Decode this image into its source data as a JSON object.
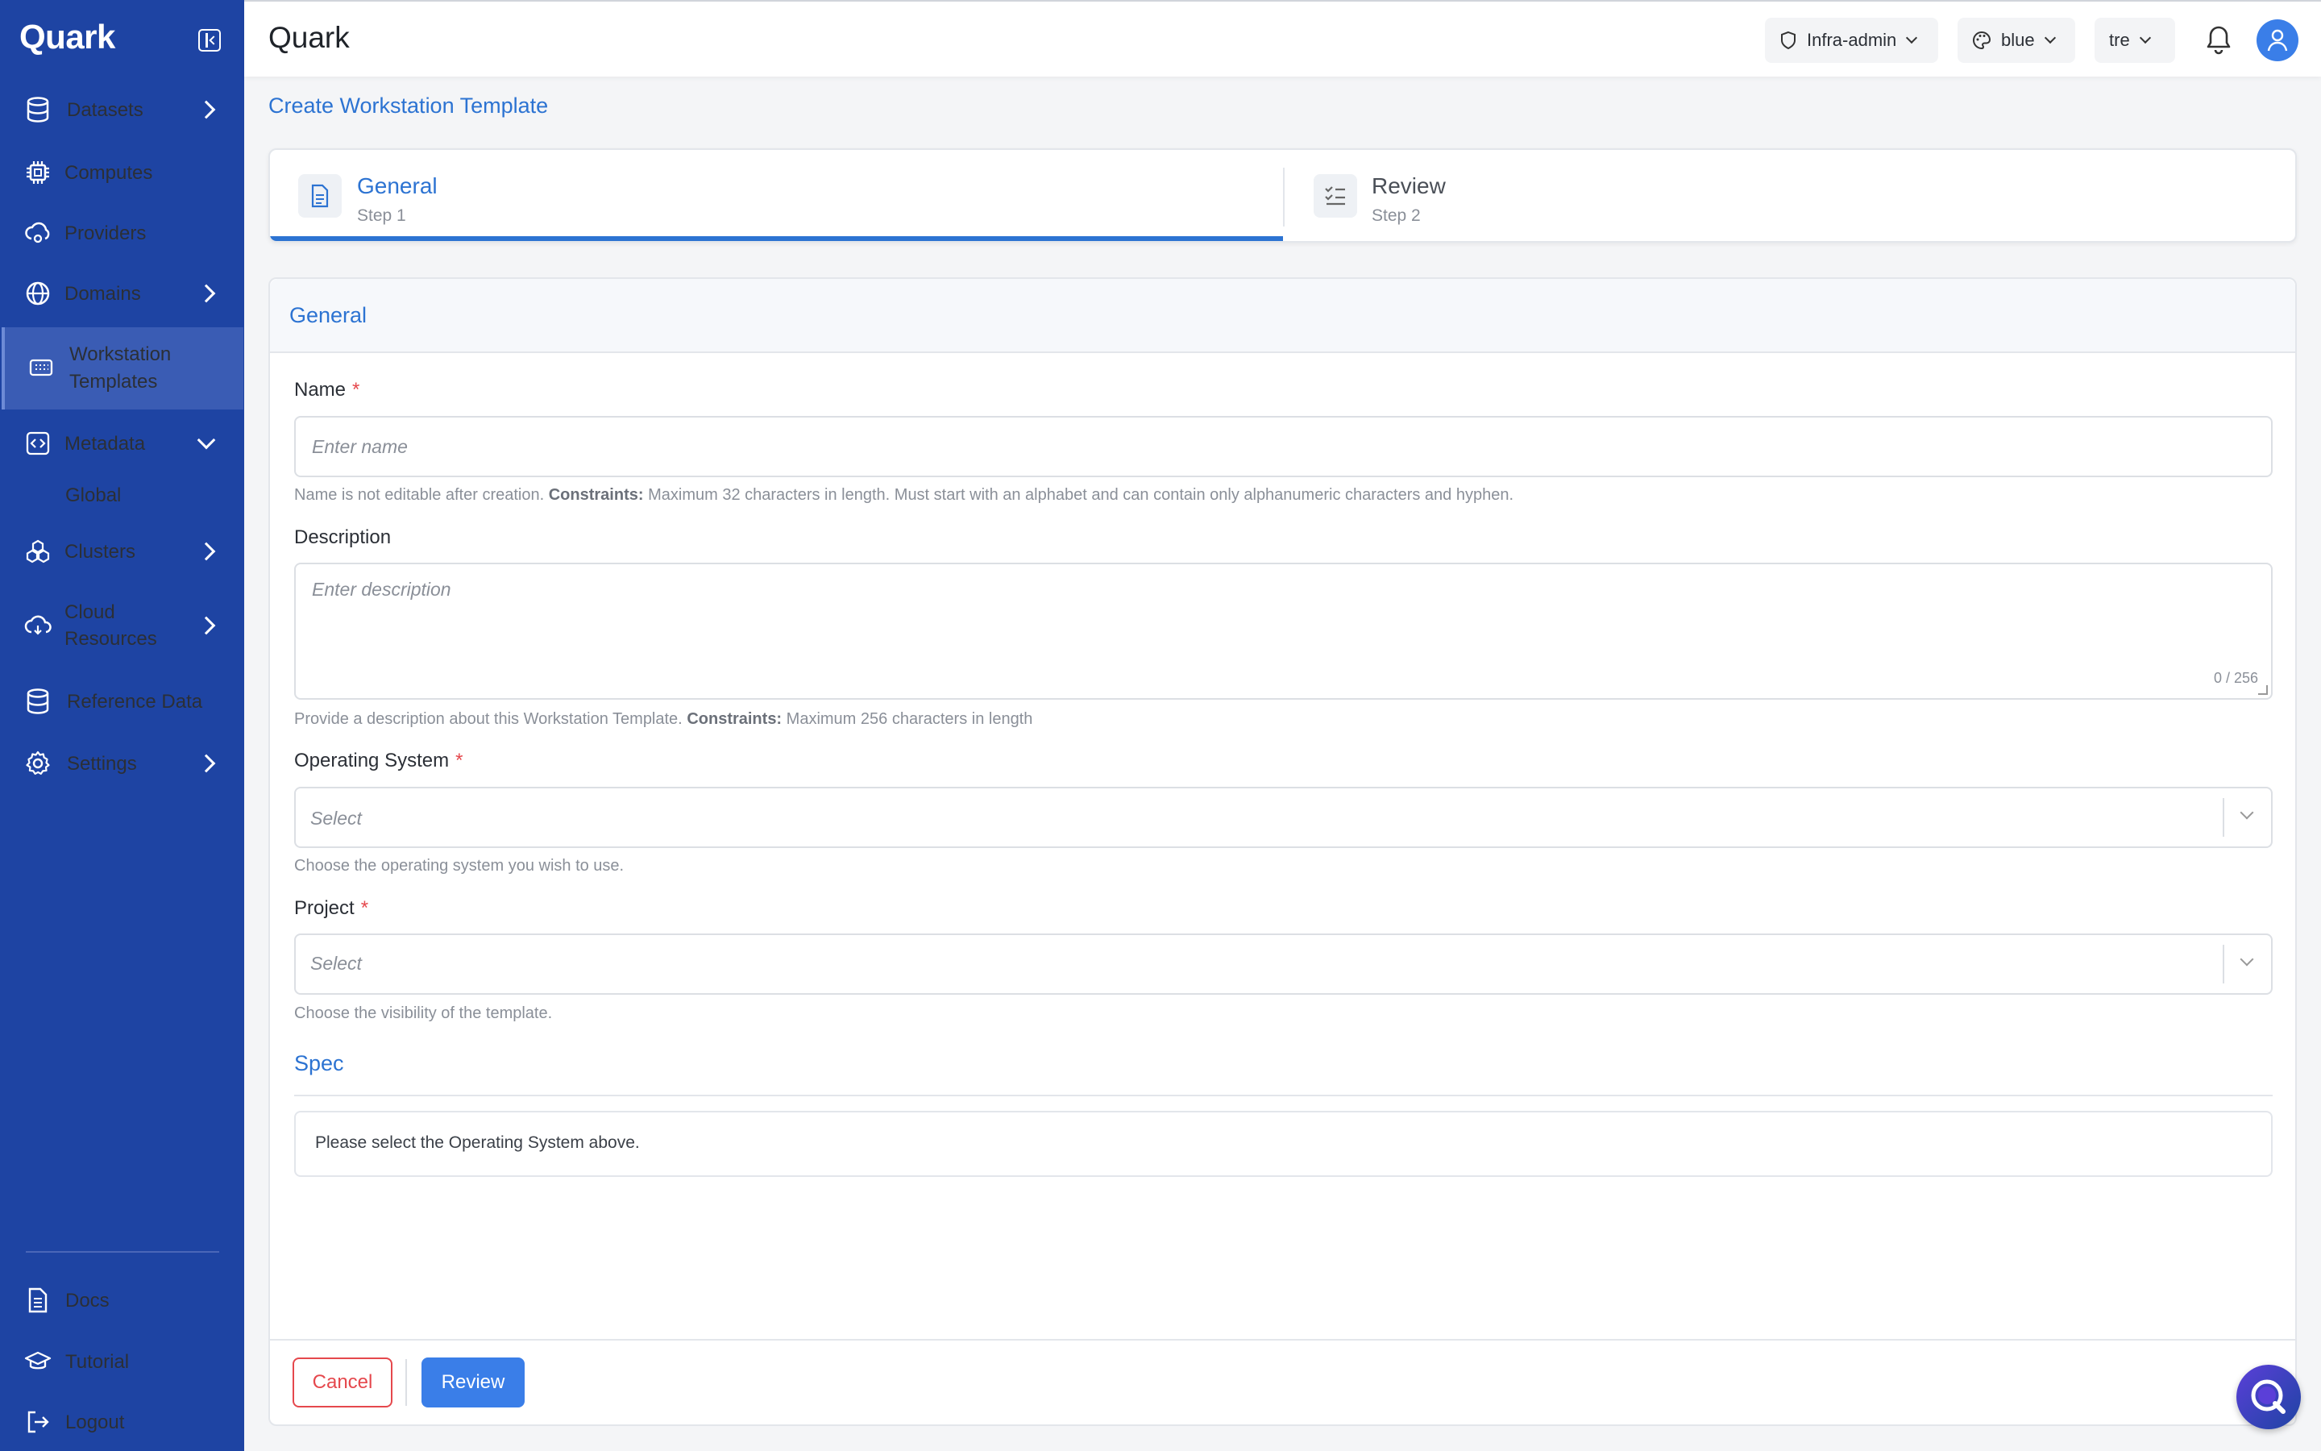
{
  "app": {
    "brand": "Quark",
    "title": "Quark"
  },
  "sidebar": {
    "items": [
      {
        "label": "Datasets",
        "icon": "database-icon"
      },
      {
        "label": "Computes",
        "icon": "cpu-icon"
      },
      {
        "label": "Providers",
        "icon": "cloud-provider-icon"
      },
      {
        "label": "Domains",
        "icon": "globe-icon"
      },
      {
        "label": "Workstation Templates",
        "icon": "workstation-icon"
      },
      {
        "label": "Metadata",
        "icon": "code-bracket-icon"
      },
      {
        "label": "Global",
        "icon": ""
      },
      {
        "label": "Clusters",
        "icon": "cluster-icon"
      },
      {
        "label": "Cloud Resources",
        "icon": "cloud-icon"
      },
      {
        "label": "Reference Data",
        "icon": "database-icon"
      },
      {
        "label": "Settings",
        "icon": "gear-icon"
      }
    ],
    "bottom": [
      {
        "label": "Docs",
        "icon": "document-icon"
      },
      {
        "label": "Tutorial",
        "icon": "graduation-cap-icon"
      },
      {
        "label": "Logout",
        "icon": "logout-icon"
      }
    ]
  },
  "header": {
    "role": "Infra-admin",
    "theme": "blue",
    "workspace": "tre"
  },
  "page": {
    "heading": "Create Workstation Template"
  },
  "stepper": {
    "steps": [
      {
        "title": "General",
        "subtitle": "Step 1"
      },
      {
        "title": "Review",
        "subtitle": "Step 2"
      }
    ],
    "progress_fraction": 0.5
  },
  "form": {
    "section_title": "General",
    "name": {
      "label": "Name",
      "placeholder": "Enter name",
      "help_prefix": "Name is not editable after creation.",
      "help_bold": "Constraints:",
      "help_suffix": "Maximum 32 characters in length. Must start with an alphabet and can contain only alphanumeric characters and hyphen."
    },
    "description": {
      "label": "Description",
      "placeholder": "Enter description",
      "counter": "0 / 256",
      "help_prefix": "Provide a description about this Workstation Template.",
      "help_bold": "Constraints:",
      "help_suffix": "Maximum 256 characters in length"
    },
    "os": {
      "label": "Operating System",
      "placeholder": "Select",
      "help": "Choose the operating system you wish to use."
    },
    "project": {
      "label": "Project",
      "placeholder": "Select",
      "help": "Choose the visibility of the template."
    },
    "spec": {
      "title": "Spec",
      "message": "Please select the Operating System above."
    },
    "required_mark": "*"
  },
  "actions": {
    "cancel": "Cancel",
    "review": "Review"
  },
  "colors": {
    "sidebar": "#1e44a3",
    "accent": "#2c73d2",
    "primary_button": "#3a7ee8",
    "danger": "#e5484d"
  }
}
